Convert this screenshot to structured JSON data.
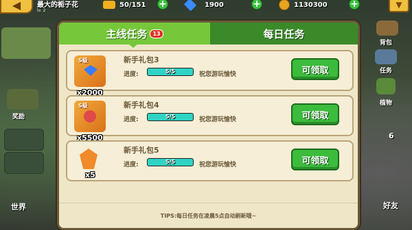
{
  "player": {
    "name": "最大的栀子花",
    "level": "lv. 2"
  },
  "resources": [
    {
      "name": "energy",
      "value": "50/151",
      "icon": "bolt-icon"
    },
    {
      "name": "gems",
      "value": "1900",
      "icon": "gem-icon"
    },
    {
      "name": "coins",
      "value": "1130300",
      "icon": "coin-icon"
    }
  ],
  "side_left": [
    "奖励",
    "世界"
  ],
  "side_right": [
    "背包",
    "任务",
    "植物",
    "6",
    "好友"
  ],
  "tabs": {
    "main": "主线任务",
    "main_badge": "13",
    "daily": "每日任务"
  },
  "quests": [
    {
      "title": "新手礼包3",
      "progress_label": "进度:",
      "progress_text": "5/5",
      "progress": 1.0,
      "desc": "祝您游玩愉快",
      "reward_grade": "S级",
      "reward_qty": "x2000",
      "claim": "可领取",
      "reward_color": "#3a7cff"
    },
    {
      "title": "新手礼包4",
      "progress_label": "进度:",
      "progress_text": "5/5",
      "progress": 1.0,
      "desc": "祝您游玩愉快",
      "reward_grade": "S级",
      "reward_qty": "x5500",
      "claim": "可领取",
      "reward_color": "#e04a4a"
    },
    {
      "title": "新手礼包5",
      "progress_label": "进度:",
      "progress_text": "5/5",
      "progress": 1.0,
      "desc": "祝您游玩愉快",
      "reward_grade": "",
      "reward_qty": "x5",
      "claim": "可领取",
      "reward_color": "#f08a2a"
    }
  ],
  "tips": "TIPS:每日任务在凌晨5点自动刷新哦~"
}
